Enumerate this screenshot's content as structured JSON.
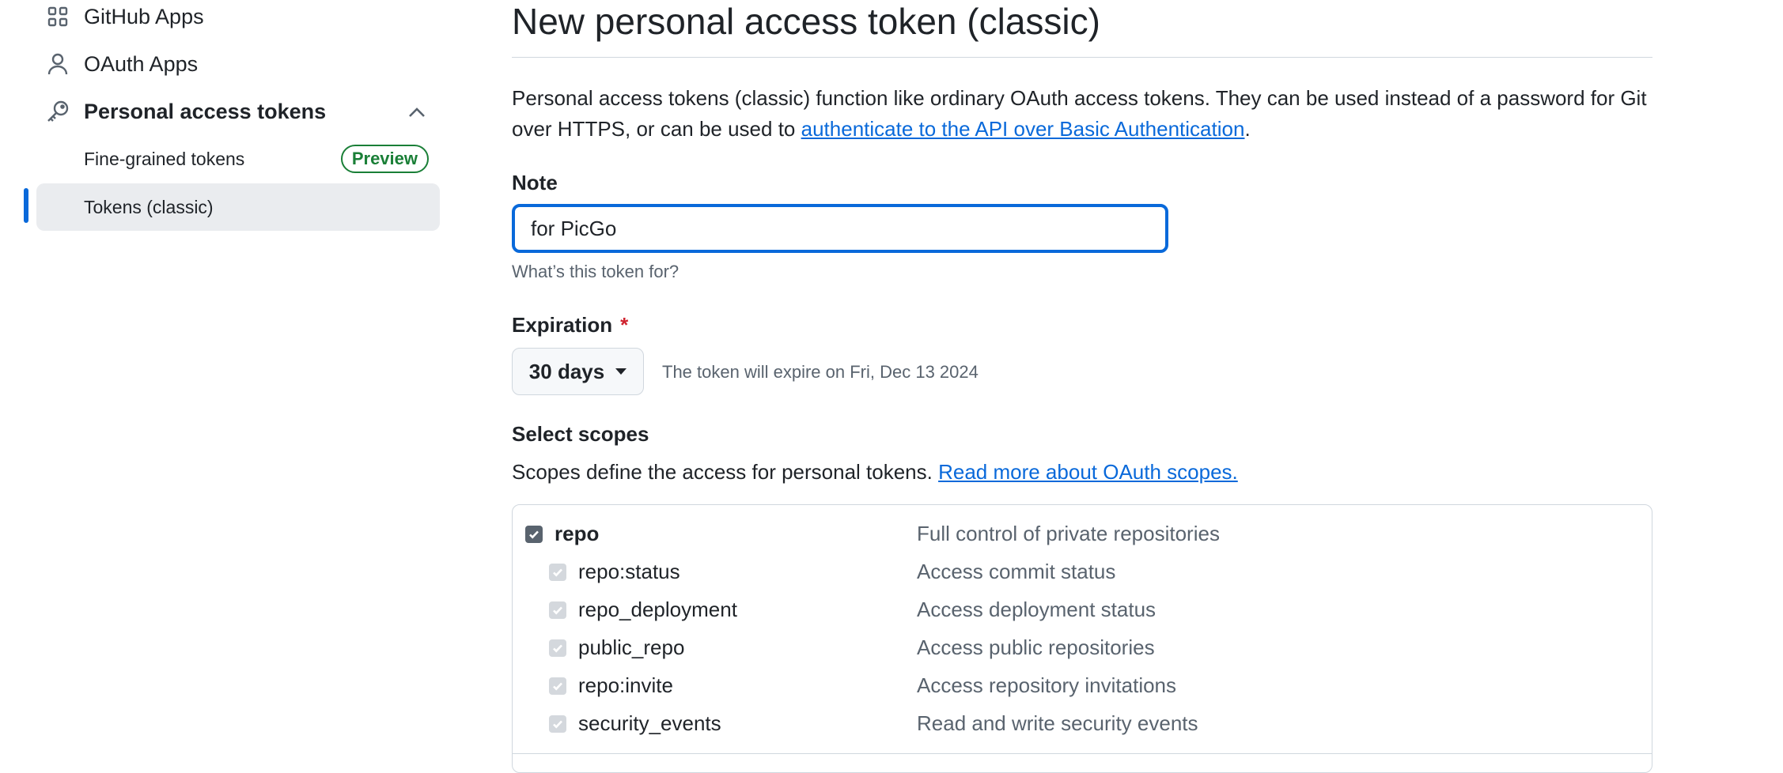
{
  "sidebar": {
    "github_apps": "GitHub Apps",
    "oauth_apps": "OAuth Apps",
    "personal_access_tokens": "Personal access tokens",
    "fine_grained": "Fine-grained tokens",
    "preview_badge": "Preview",
    "tokens_classic": "Tokens (classic)"
  },
  "main": {
    "title": "New personal access token (classic)",
    "desc_text": "Personal access tokens (classic) function like ordinary OAuth access tokens. They can be used instead of a password for Git over HTTPS, or can be used to ",
    "desc_link": "authenticate to the API over Basic Authentication",
    "desc_end": ".",
    "note_label": "Note",
    "note_value": "for PicGo",
    "note_hint": "What’s this token for?",
    "expiration_label": "Expiration",
    "required_mark": "*",
    "expiration_value": "30 days",
    "expiration_note": "The token will expire on Fri, Dec 13 2024",
    "scopes_label": "Select scopes",
    "scopes_desc": "Scopes define the access for personal tokens. ",
    "scopes_link": "Read more about OAuth scopes."
  },
  "scopes": [
    {
      "name": "repo",
      "desc": "Full control of private repositories",
      "checked": true,
      "parent": true
    },
    {
      "name": "repo:status",
      "desc": "Access commit status",
      "checked": true,
      "parent": false
    },
    {
      "name": "repo_deployment",
      "desc": "Access deployment status",
      "checked": true,
      "parent": false
    },
    {
      "name": "public_repo",
      "desc": "Access public repositories",
      "checked": true,
      "parent": false
    },
    {
      "name": "repo:invite",
      "desc": "Access repository invitations",
      "checked": true,
      "parent": false
    },
    {
      "name": "security_events",
      "desc": "Read and write security events",
      "checked": true,
      "parent": false
    }
  ],
  "colors": {
    "accent": "#0969da",
    "selected_bg": "#eaecef",
    "preview_green": "#1a7f37",
    "required_red": "#cf222e"
  }
}
